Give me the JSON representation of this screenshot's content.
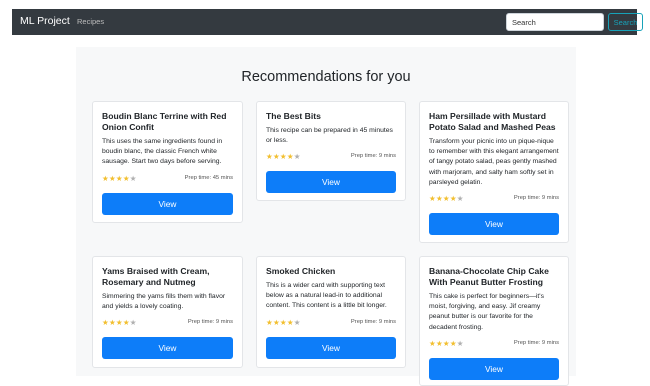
{
  "navbar": {
    "brand": "ML Project",
    "link_recipes": "Recipes",
    "search_placeholder": "Search",
    "search_button": "Search"
  },
  "page": {
    "title": "Recommendations for you"
  },
  "colors": {
    "navbar_bg": "#343a40",
    "primary": "#0d7df9",
    "outline_info": "#17a2b8",
    "star": "#f2bf2f"
  },
  "cards": [
    {
      "title": "Boudin Blanc Terrine with Red Onion Confit",
      "text": "This uses the same ingredients found in boudin blanc, the classic French white sausage. Start two days before serving.",
      "rating": 4,
      "max_rating": 5,
      "prep": "Prep time: 45 mins",
      "button": "View"
    },
    {
      "title": "The Best Bits",
      "text": "This recipe can be prepared in 45 minutes or less.",
      "rating": 4,
      "max_rating": 5,
      "prep": "Prep time: 9 mins",
      "button": "View"
    },
    {
      "title": "Ham Persillade with Mustard Potato Salad and Mashed Peas",
      "text": "Transform your picnic into un pique-nique to remember with this elegant arrangement of tangy potato salad, peas gently mashed with marjoram, and salty ham softly set in parsleyed gelatin.",
      "rating": 4,
      "max_rating": 5,
      "prep": "Prep time: 9 mins",
      "button": "View"
    },
    {
      "title": "Yams Braised with Cream, Rosemary and Nutmeg",
      "text": "Simmering the yams fills them with flavor and yields a lovely coating.",
      "rating": 4,
      "max_rating": 5,
      "prep": "Prep time: 9 mins",
      "button": "View"
    },
    {
      "title": "Smoked Chicken",
      "text": "This is a wider card with supporting text below as a natural lead-in to additional content. This content is a little bit longer.",
      "rating": 4,
      "max_rating": 5,
      "prep": "Prep time: 9 mins",
      "button": "View"
    },
    {
      "title": "Banana-Chocolate Chip Cake With Peanut Butter Frosting",
      "text": "This cake is perfect for beginners—it's moist, forgiving, and easy. Jif creamy peanut butter is our favorite for the decadent frosting.",
      "rating": 4,
      "max_rating": 5,
      "prep": "Prep time: 9 mins",
      "button": "View"
    }
  ]
}
